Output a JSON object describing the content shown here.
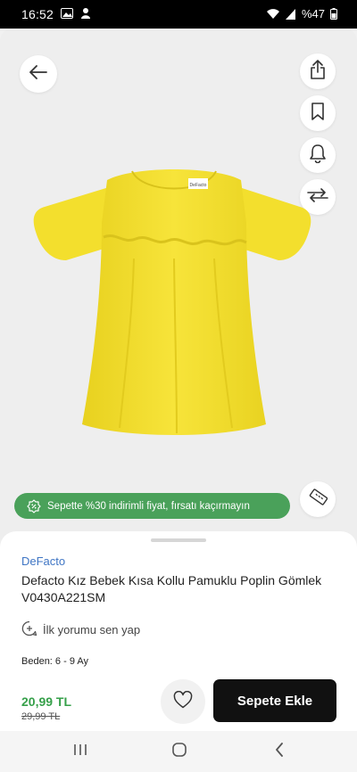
{
  "status_bar": {
    "time": "16:52",
    "battery": "%47"
  },
  "product": {
    "brand": "DeFacto",
    "title": "Defacto Kız Bebek Kısa Kollu Pamuklu Poplin Gömlek V0430A221SM",
    "image_color": "#f4e131",
    "label_text": "DeFacto"
  },
  "promo": {
    "text": "Sepette %30 indirimli fiyat, fırsatı kaçırmayın",
    "color": "#4aa15a"
  },
  "review": {
    "label": "İlk yorumu sen yap"
  },
  "size": {
    "label": "Beden: 6 - 9 Ay"
  },
  "pricing": {
    "price": "20,99 TL",
    "old_price": "29,99 TL",
    "price_color": "#36a04a"
  },
  "actions": {
    "add_to_cart": "Sepete Ekle"
  },
  "icons": {
    "back": "arrow-left-icon",
    "share": "share-icon",
    "bookmark": "bookmark-icon",
    "bell": "bell-icon",
    "compare": "compare-arrows-icon",
    "size_guide": "ruler-icon",
    "favorite": "heart-icon"
  }
}
